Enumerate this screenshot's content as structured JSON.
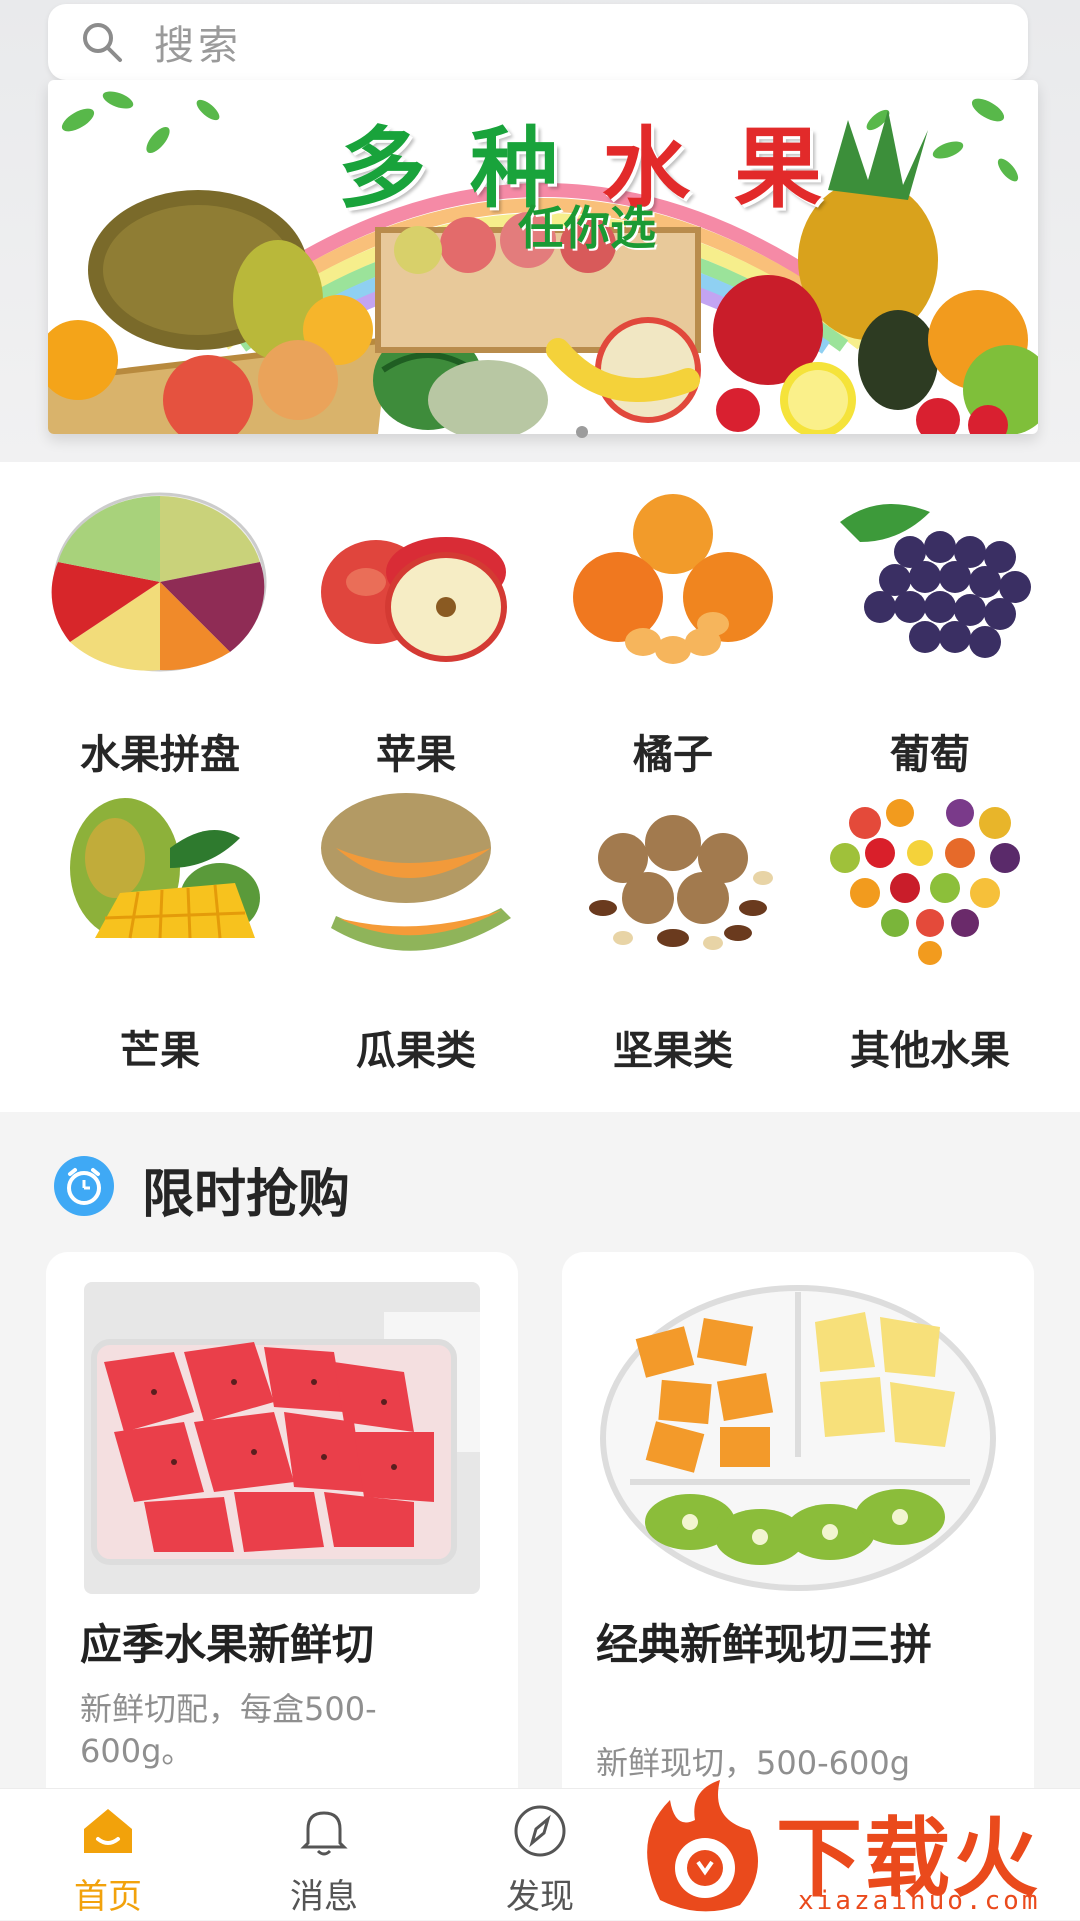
{
  "search": {
    "placeholder": "搜索"
  },
  "banner": {
    "title_parts": [
      "多",
      "种",
      "水",
      "果"
    ],
    "subtitle": "任你选"
  },
  "categories": [
    {
      "label": "水果拼盘",
      "icon": "fruit-platter-icon"
    },
    {
      "label": "苹果",
      "icon": "apple-icon"
    },
    {
      "label": "橘子",
      "icon": "orange-icon"
    },
    {
      "label": "葡萄",
      "icon": "grape-icon"
    },
    {
      "label": "芒果",
      "icon": "mango-icon"
    },
    {
      "label": "瓜果类",
      "icon": "melon-icon"
    },
    {
      "label": "坚果类",
      "icon": "nuts-icon"
    },
    {
      "label": "其他水果",
      "icon": "mixed-fruit-heart-icon"
    }
  ],
  "flash_sale": {
    "title": "限时抢购",
    "icon": "alarm-clock-icon",
    "items": [
      {
        "name": "应季水果新鲜切",
        "desc": "新鲜切配，每盒500-600g。"
      },
      {
        "name": "经典新鲜现切三拼",
        "desc": "新鲜现切，500-600g"
      }
    ]
  },
  "nav": {
    "tabs": [
      {
        "label": "首页",
        "icon": "home-icon",
        "active": true
      },
      {
        "label": "消息",
        "icon": "bell-icon",
        "active": false
      },
      {
        "label": "发现",
        "icon": "compass-icon",
        "active": false
      }
    ]
  },
  "watermark": {
    "brand": "下载火",
    "domain": "xiazaihuo.com"
  },
  "colors": {
    "accent": "#f2a20b",
    "brand_watermark": "#ea4a1c",
    "clock_blue": "#3fa9f5"
  }
}
